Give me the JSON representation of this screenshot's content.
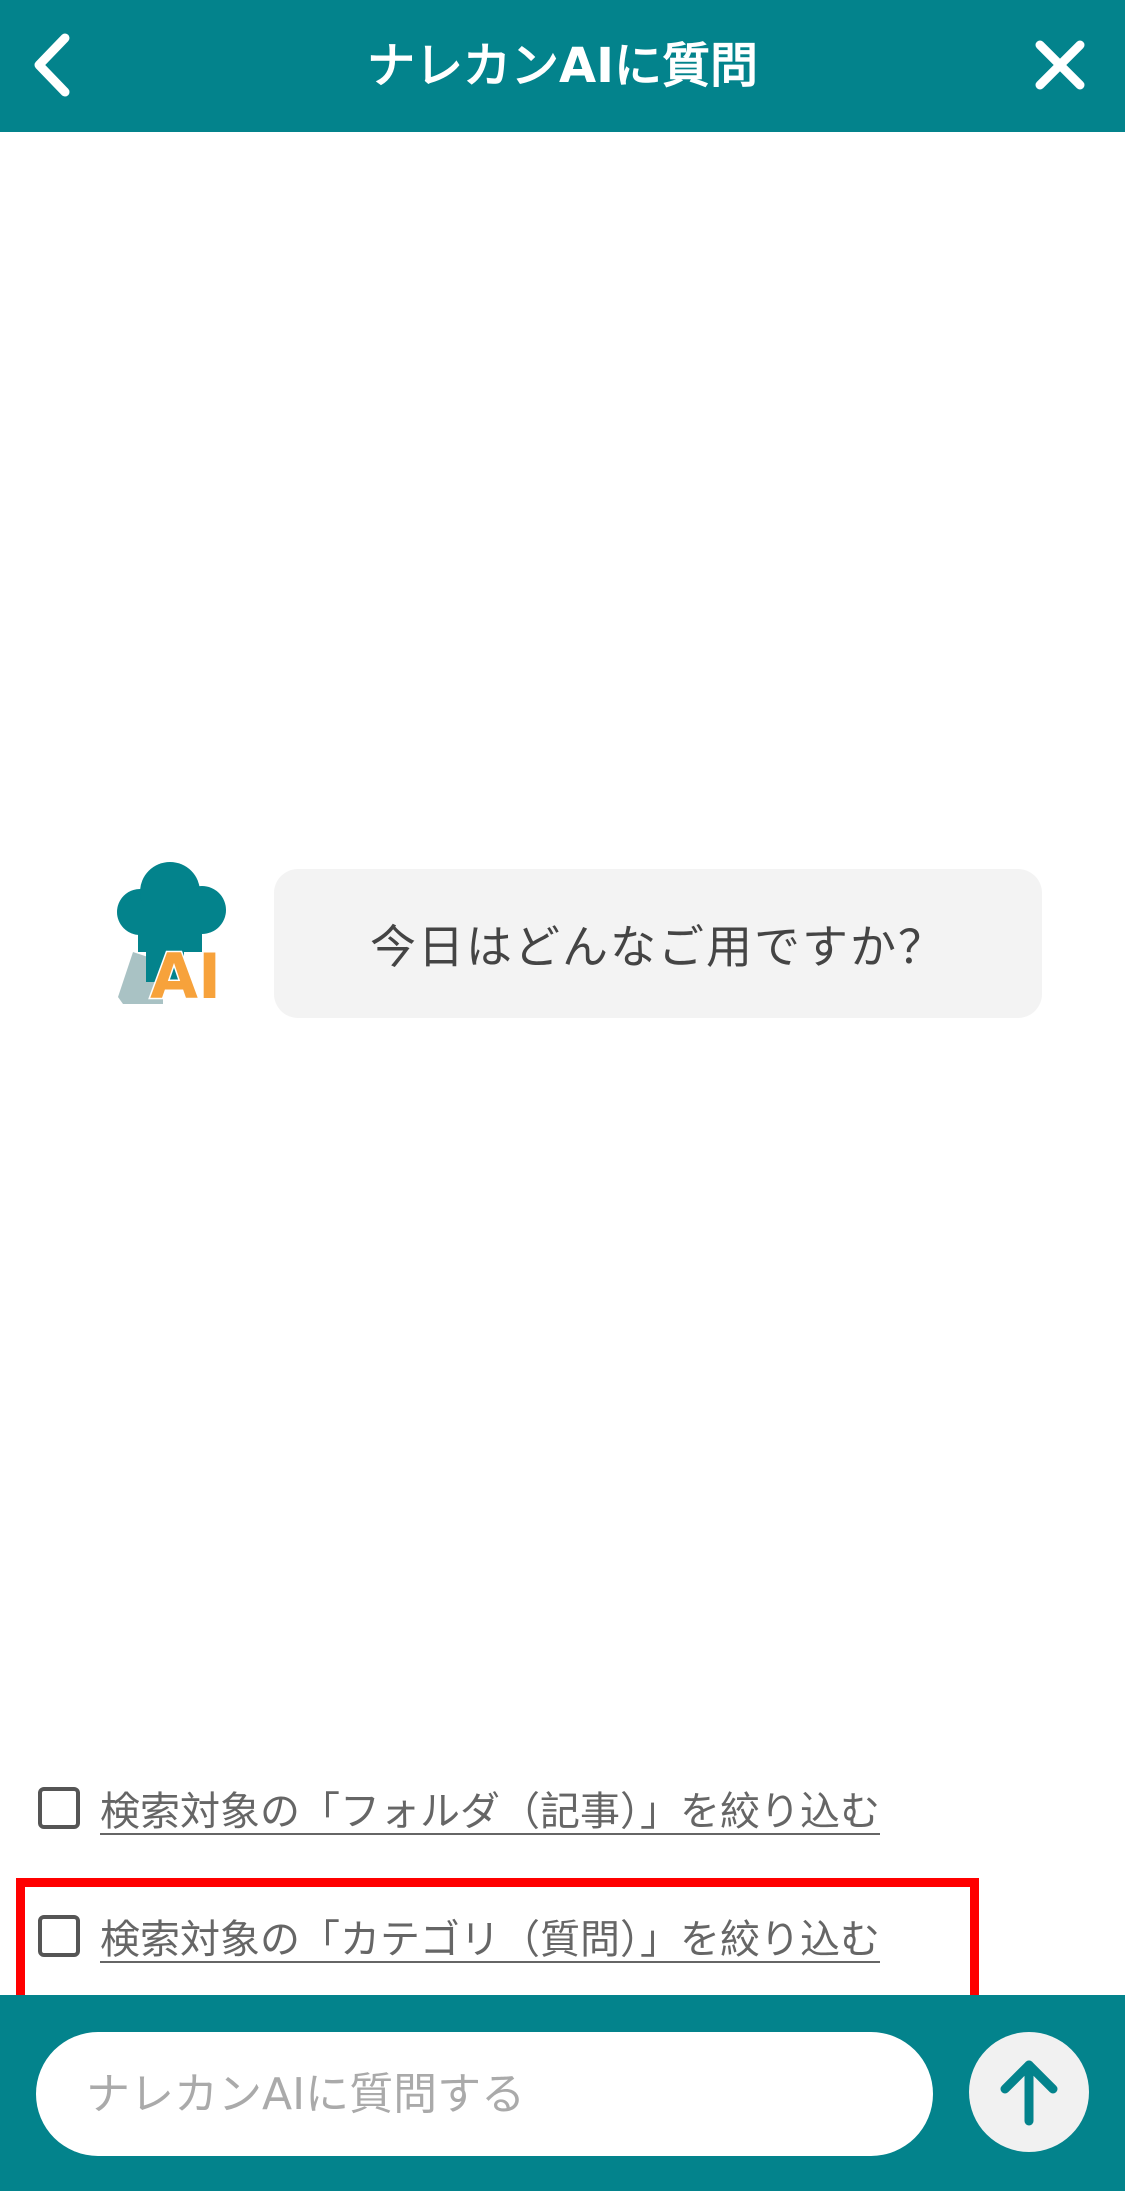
{
  "header": {
    "title": "ナレカンAIに質問",
    "back_icon": "chevron-left-icon",
    "close_icon": "close-icon",
    "background_color": "#03838c"
  },
  "chat": {
    "avatar_icon": "ai-chef-avatar-icon",
    "avatar_text": "AI",
    "messages": [
      {
        "sender": "ai",
        "text": "今日はどんなご用ですか？"
      }
    ]
  },
  "filters": [
    {
      "label": "検索対象の「フォルダ（記事）」を絞り込む",
      "checked": false
    },
    {
      "label": "検索対象の「カテゴリ（質問）」を絞り込む",
      "checked": false,
      "highlighted": true
    }
  ],
  "composer": {
    "placeholder": "ナレカンAIに質問する",
    "value": "",
    "send_icon": "arrow-up-icon"
  },
  "colors": {
    "accent": "#03838c",
    "highlight": "#ff0000",
    "avatar_orange": "#f7a23b"
  }
}
